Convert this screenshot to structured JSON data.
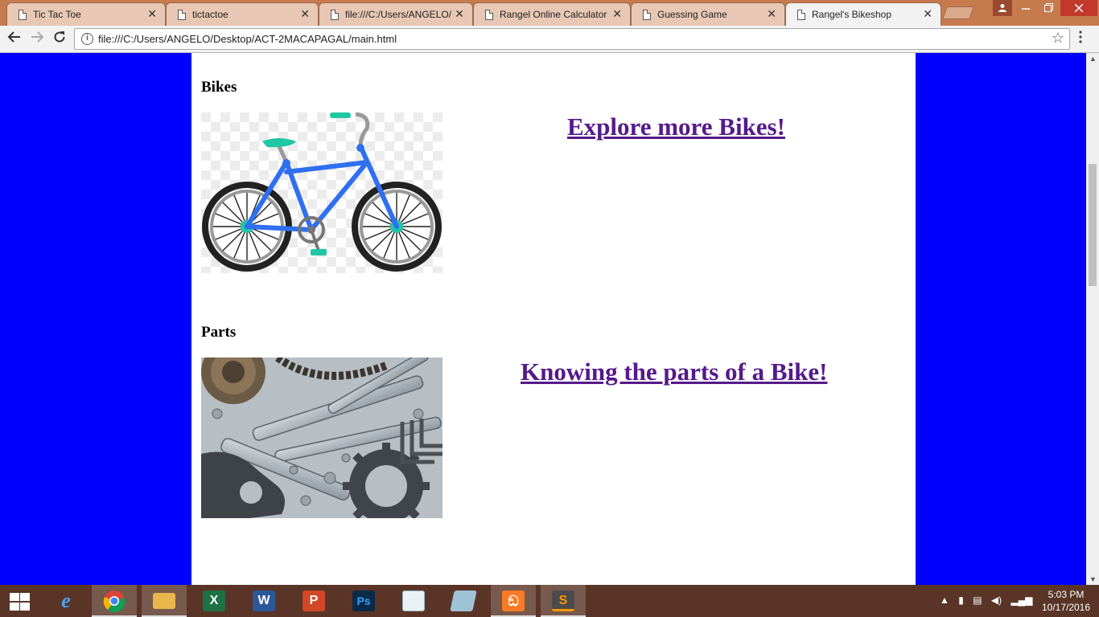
{
  "browser": {
    "tabs": [
      {
        "title": "Tic Tac Toe",
        "active": false
      },
      {
        "title": "tictactoe",
        "active": false
      },
      {
        "title": "file:///C:/Users/ANGELO/",
        "active": false
      },
      {
        "title": "Rangel Online Calculator",
        "active": false
      },
      {
        "title": "Guessing Game",
        "active": false
      },
      {
        "title": "Rangel's Bikeshop",
        "active": true
      }
    ],
    "url": "file:///C:/Users/ANGELO/Desktop/ACT-2MACAPAGAL/main.html",
    "close_glyph": "✕"
  },
  "page": {
    "background_color": "#0000ff",
    "link_color": "#551a8b",
    "sections": [
      {
        "heading": "Bikes",
        "link_text": "Explore more Bikes!",
        "image": "bicycle-image"
      },
      {
        "heading": "Parts",
        "link_text": "Knowing the parts of a Bike!",
        "image": "bike-parts-image"
      }
    ]
  },
  "taskbar": {
    "apps": [
      "internet-explorer",
      "chrome",
      "file-explorer",
      "excel",
      "word",
      "powerpoint",
      "photoshop",
      "mysql-installer",
      "notes",
      "xampp",
      "sublime-text"
    ],
    "clock_time": "5:03 PM",
    "clock_date": "10/17/2016"
  }
}
